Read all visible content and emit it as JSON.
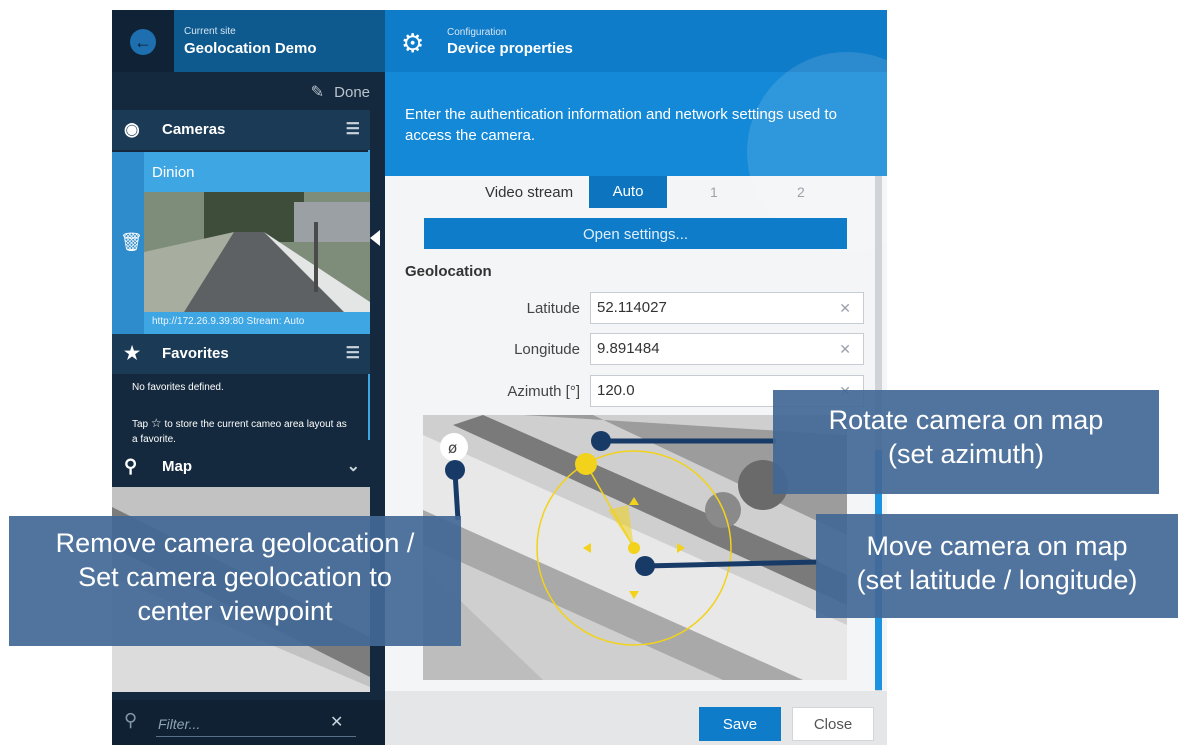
{
  "site": {
    "caption": "Current site",
    "name": "Geolocation Demo"
  },
  "toolbar": {
    "done_label": "Done"
  },
  "sections": {
    "cameras": {
      "label": "Cameras"
    },
    "favorites": {
      "label": "Favorites",
      "empty_text": "No favorites defined.",
      "hint_before": "Tap",
      "hint_after": "to store the current cameo area layout as a favorite."
    },
    "map": {
      "label": "Map"
    }
  },
  "camera": {
    "name": "Dinion",
    "url_text": "http://172.26.9.39:80 Stream: Auto"
  },
  "filter": {
    "placeholder": "Filter..."
  },
  "config": {
    "caption": "Configuration",
    "title": "Device properties",
    "description": "Enter the authentication information and network settings used to access the camera."
  },
  "video_stream": {
    "label": "Video stream",
    "options": [
      "Auto",
      "1",
      "2"
    ],
    "selected": "Auto"
  },
  "open_settings_label": "Open settings...",
  "geolocation": {
    "title": "Geolocation",
    "latitude": {
      "label": "Latitude",
      "value": "52.114027"
    },
    "longitude": {
      "label": "Longitude",
      "value": "9.891484"
    },
    "azimuth": {
      "label": "Azimuth [°]",
      "value": "120.0"
    }
  },
  "footer": {
    "save_label": "Save",
    "close_label": "Close"
  },
  "callouts": {
    "rotate": [
      "Rotate camera on map",
      "(set azimuth)"
    ],
    "move": [
      "Move camera on map",
      "(set latitude / longitude)"
    ],
    "remove": [
      "Remove camera geolocation /",
      "Set camera geolocation to",
      "center viewpoint"
    ]
  },
  "colors": {
    "accent": "#0f7cc9",
    "callout_bg": "#426896",
    "gizmo_yellow": "#f2d21a",
    "annotation_line": "#173a66"
  },
  "icons": [
    "back-arrow-icon",
    "edit-icon",
    "camera-icon",
    "hamburger-icon",
    "trash-icon",
    "star-icon",
    "map-pin-icon",
    "chevron-down-icon",
    "search-icon",
    "clear-icon",
    "gear-icon",
    "info-icon",
    "geo-clear-icon"
  ]
}
